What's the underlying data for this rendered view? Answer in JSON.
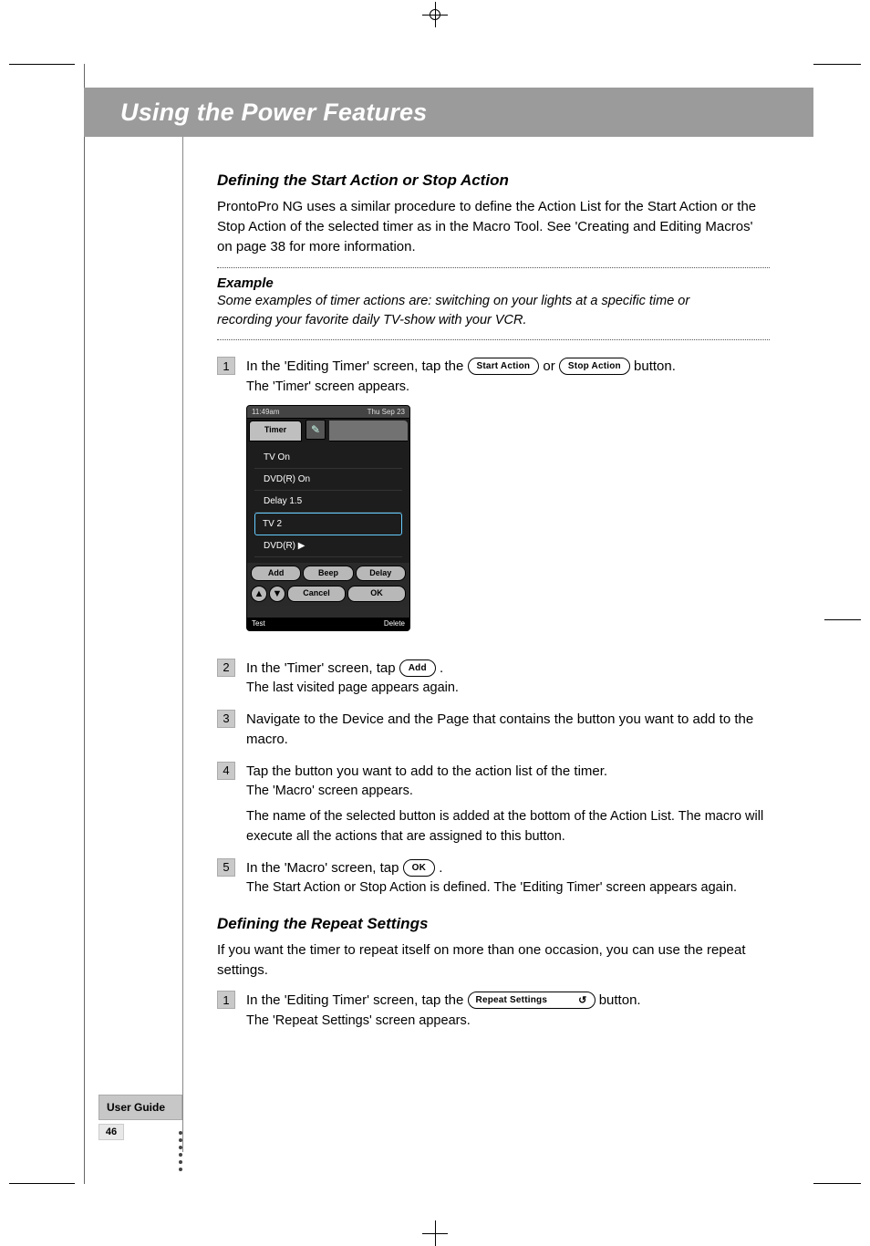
{
  "title_bar": "Using the Power Features",
  "section1": {
    "heading": "Defining the Start Action or Stop Action",
    "paragraph": "ProntoPro NG uses a similar procedure to define the Action List for the Start Action or the Stop Action of the selected timer as in the Macro Tool. See 'Creating and Editing Macros' on page 38 for more information."
  },
  "example": {
    "label": "Example",
    "text": "Some examples of timer actions are: switching on your lights at a specific time or recording your favorite daily TV-show with your VCR."
  },
  "buttons": {
    "start_action": "Start Action",
    "stop_action": "Stop Action",
    "add": "Add",
    "ok": "OK",
    "repeat_settings": "Repeat Settings"
  },
  "steps1": [
    {
      "n": "1",
      "lead_a": "In the 'Editing Timer' screen, tap the ",
      "lead_b": " or ",
      "lead_c": " button.",
      "sub": "The 'Timer' screen appears."
    },
    {
      "n": "2",
      "lead_a": "In the 'Timer' screen, tap ",
      "lead_b": ".",
      "sub": "The last visited page appears again."
    },
    {
      "n": "3",
      "lead": "Navigate to the Device and the Page that contains the button you want to add to the macro."
    },
    {
      "n": "4",
      "lead": "Tap the button you want to add to the action list of the timer.",
      "sub": "The 'Macro' screen appears.",
      "extra": "The name of the selected button is added at the bottom of the Action List. The macro will execute all the actions that are assigned to this button."
    },
    {
      "n": "5",
      "lead_a": "In the 'Macro' screen, tap ",
      "lead_b": ".",
      "sub": "The Start Action or Stop Action is defined. The 'Editing Timer' screen appears again."
    }
  ],
  "section2": {
    "heading": "Defining the Repeat Settings",
    "paragraph": "If you want the timer to repeat itself on more than one occasion, you can use the repeat settings."
  },
  "steps2": [
    {
      "n": "1",
      "lead_a": "In the 'Editing Timer' screen, tap the ",
      "lead_b": " button.",
      "sub": "The 'Repeat Settings' screen appears."
    }
  ],
  "device": {
    "time": "11:49am",
    "date": "Thu Sep 23",
    "tab": "Timer",
    "list": [
      "TV On",
      "DVD(R) On",
      "Delay  1.5",
      "TV 2",
      "DVD(R) ▶"
    ],
    "row1": [
      "Add",
      "Beep",
      "Delay"
    ],
    "row2_cancel": "Cancel",
    "row2_ok": "OK",
    "footer_l": "Test",
    "footer_r": "Delete"
  },
  "footer": {
    "user_guide": "User Guide",
    "page_no": "46"
  }
}
